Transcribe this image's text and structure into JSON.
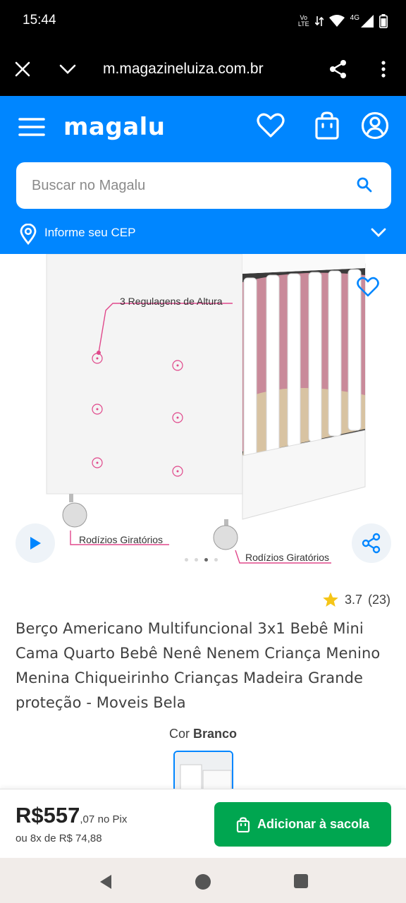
{
  "status_bar": {
    "time": "15:44",
    "volte_top": "Vo",
    "volte_bottom": "LTE",
    "network": "4G"
  },
  "browser": {
    "url": "m.magazineluiza.com.br"
  },
  "header": {
    "logo": "magalu",
    "search_placeholder": "Buscar no Magalu",
    "cep_label": "Informe seu CEP",
    "brand_color": "#0086ff"
  },
  "product_image": {
    "label_heights": "3 Regulagens de Altura",
    "label_wheels_left": "Rodízios Giratórios",
    "label_wheels_right": "Rodízios Giratórios",
    "total_slides": 4,
    "active_slide": 3
  },
  "rating": {
    "score": "3.7",
    "count": "(23)",
    "star_color": "#f5c518"
  },
  "product": {
    "title": "Berço Americano Multifuncional 3x1 Bebê Mini Cama Quarto Bebê Nenê Nenem Criança Menino Menina Chiqueirinho Crianças Madeira Grande proteção - Moveis Bela",
    "color_label": "Cor",
    "color_value": "Branco"
  },
  "buy": {
    "price_main": "R$557",
    "price_cents": ",07",
    "price_suffix": "no Pix",
    "installments": "ou 8x de R$ 74,88",
    "add_button": "Adicionar à sacola",
    "button_color": "#00a650"
  }
}
